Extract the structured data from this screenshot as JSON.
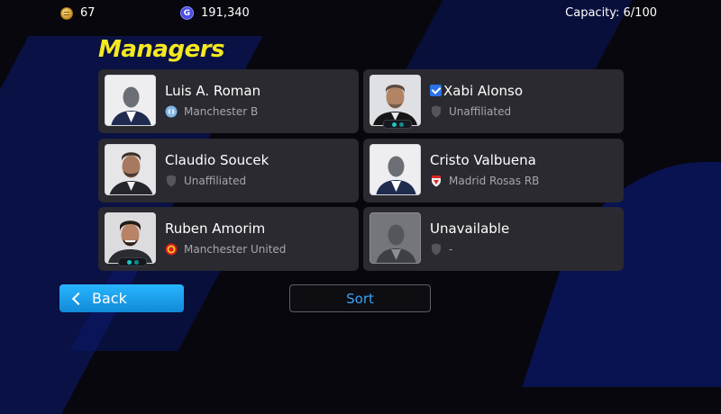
{
  "topbar": {
    "coins": "67",
    "gp": "191,340",
    "capacity": "Capacity: 6/100",
    "coin_icon": "coin-icon",
    "gp_icon": "gp-icon"
  },
  "title": "Managers",
  "managers": [
    {
      "name": "Luis A. Roman",
      "club": "Manchester B",
      "club_icon": "manchester-b-crest-icon",
      "portrait": "silhouette",
      "verified": false,
      "badge": false
    },
    {
      "name": "Xabi Alonso",
      "club": "Unaffiliated",
      "club_icon": "shield-icon",
      "portrait": "photo",
      "verified": true,
      "badge": true
    },
    {
      "name": "Claudio Soucek",
      "club": "Unaffiliated",
      "club_icon": "shield-icon",
      "portrait": "photo",
      "verified": false,
      "badge": false
    },
    {
      "name": "Cristo Valbuena",
      "club": "Madrid Rosas RB",
      "club_icon": "madrid-rosas-crest-icon",
      "portrait": "silhouette",
      "verified": false,
      "badge": false
    },
    {
      "name": "Ruben Amorim",
      "club": "Manchester United",
      "club_icon": "manchester-united-crest-icon",
      "portrait": "photo",
      "verified": false,
      "badge": true
    },
    {
      "name": "Unavailable",
      "club": "-",
      "club_icon": "shield-icon",
      "portrait": "silhouette-grey",
      "verified": false,
      "badge": false
    }
  ],
  "buttons": {
    "back_label": "Back",
    "sort_label": "Sort"
  },
  "colors": {
    "title": "#f4e820",
    "accent_blue": "#1e9ff0",
    "card_bg": "#2a2a30",
    "badge_teal": "#19c6c2"
  }
}
